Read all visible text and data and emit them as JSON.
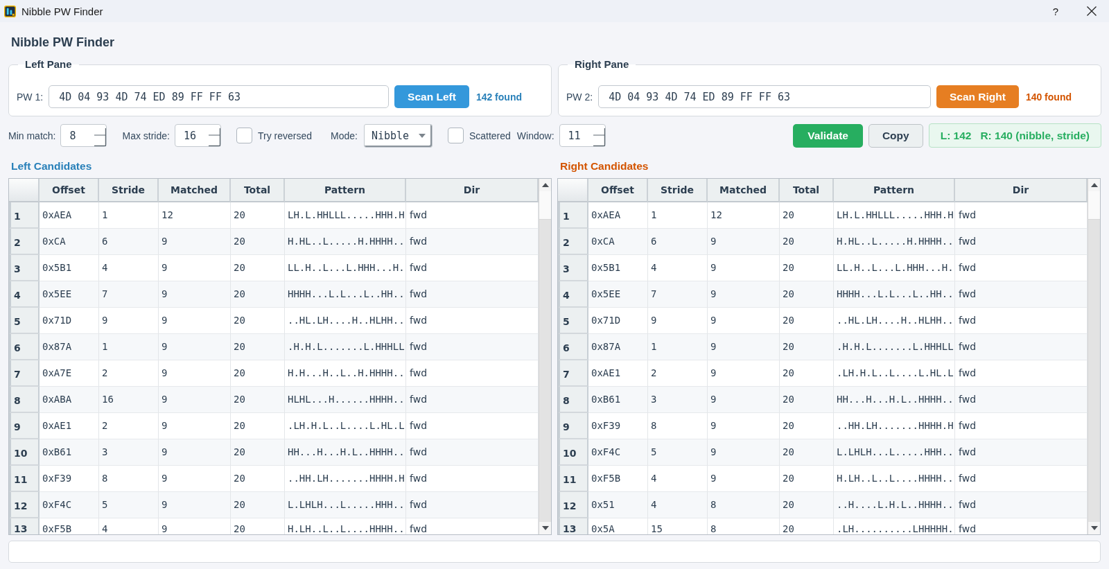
{
  "window": {
    "title": "Nibble PW Finder",
    "help_button": "?"
  },
  "heading": "Nibble PW Finder",
  "panes": [
    {
      "title": "Left Pane",
      "field_label": "PW 1:",
      "value": "4D 04 93 4D 74 ED 89 FF FF 63",
      "button": "Scan Left",
      "result": "142 found",
      "color": "#3498db"
    },
    {
      "title": "Right Pane",
      "field_label": "PW 2:",
      "value": "4D 04 93 4D 74 ED 89 FF FF 63",
      "button": "Scan Right",
      "result": "140 found",
      "color": "#e67e22"
    }
  ],
  "options": [
    {
      "kind": "spin",
      "label": "Min match:",
      "value": "8"
    },
    {
      "kind": "spin",
      "label": "Max stride:",
      "value": "16"
    },
    {
      "kind": "check",
      "label": "Try reversed",
      "checked": false
    },
    {
      "kind": "combo",
      "label": "Mode:",
      "value": "Nibble"
    },
    {
      "kind": "check",
      "label": "Scattered",
      "checked": false
    },
    {
      "kind": "spin",
      "label": "Window:",
      "value": "11"
    }
  ],
  "actions": [
    {
      "kind": "validate",
      "label": "Validate"
    },
    {
      "kind": "copy",
      "label": "Copy"
    }
  ],
  "status_badge": "L: 142   R: 140 (nibble, stride)",
  "candidate_tables": [
    {
      "title": "Left Candidates",
      "color": "#2980b9",
      "columns": [
        "Offset",
        "Stride",
        "Matched",
        "Total",
        "Pattern",
        "Dir"
      ],
      "rows": [
        {
          "number": "1",
          "cells": [
            "0xAEA",
            "1",
            "12",
            "20",
            "LH.L.HHLLL.....HHH.H",
            "fwd"
          ]
        },
        {
          "number": "2",
          "cells": [
            "0xCA",
            "6",
            "9",
            "20",
            "H.HL..L.....H.HHHH..",
            "fwd"
          ]
        },
        {
          "number": "3",
          "cells": [
            "0x5B1",
            "4",
            "9",
            "20",
            "LL.H..L...L.HHH...H.",
            "fwd"
          ]
        },
        {
          "number": "4",
          "cells": [
            "0x5EE",
            "7",
            "9",
            "20",
            "HHHH...L.L...L..HH..",
            "fwd"
          ]
        },
        {
          "number": "5",
          "cells": [
            "0x71D",
            "9",
            "9",
            "20",
            "..HL.LH....H..HLHH..",
            "fwd"
          ]
        },
        {
          "number": "6",
          "cells": [
            "0x87A",
            "1",
            "9",
            "20",
            ".H.H.L.......L.HHHLL",
            "fwd"
          ]
        },
        {
          "number": "7",
          "cells": [
            "0xA7E",
            "2",
            "9",
            "20",
            "H.H...H..L..H.HHHH..",
            "fwd"
          ]
        },
        {
          "number": "8",
          "cells": [
            "0xABA",
            "16",
            "9",
            "20",
            "HLHL...H......HHHH..",
            "fwd"
          ]
        },
        {
          "number": "9",
          "cells": [
            "0xAE1",
            "2",
            "9",
            "20",
            ".LH.H.L..L....L.HL.L",
            "fwd"
          ]
        },
        {
          "number": "10",
          "cells": [
            "0xB61",
            "3",
            "9",
            "20",
            "HH...H...H.L..HHHH..",
            "fwd"
          ]
        },
        {
          "number": "11",
          "cells": [
            "0xF39",
            "8",
            "9",
            "20",
            "..HH.LH.......HHHH.H",
            "fwd"
          ]
        },
        {
          "number": "12",
          "cells": [
            "0xF4C",
            "5",
            "9",
            "20",
            "L.LHLH...L.....HHH..",
            "fwd"
          ]
        },
        {
          "number": "13",
          "cells": [
            "0xF5B",
            "4",
            "9",
            "20",
            "H.LH..L..L....HHHH..",
            "fwd"
          ]
        }
      ]
    },
    {
      "title": "Right Candidates",
      "color": "#d35400",
      "columns": [
        "Offset",
        "Stride",
        "Matched",
        "Total",
        "Pattern",
        "Dir"
      ],
      "rows": [
        {
          "number": "1",
          "cells": [
            "0xAEA",
            "1",
            "12",
            "20",
            "LH.L.HHLLL.....HHH.H",
            "fwd"
          ]
        },
        {
          "number": "2",
          "cells": [
            "0xCA",
            "6",
            "9",
            "20",
            "H.HL..L.....H.HHHH..",
            "fwd"
          ]
        },
        {
          "number": "3",
          "cells": [
            "0x5B1",
            "4",
            "9",
            "20",
            "LL.H..L...L.HHH...H.",
            "fwd"
          ]
        },
        {
          "number": "4",
          "cells": [
            "0x5EE",
            "7",
            "9",
            "20",
            "HHHH...L.L...L..HH..",
            "fwd"
          ]
        },
        {
          "number": "5",
          "cells": [
            "0x71D",
            "9",
            "9",
            "20",
            "..HL.LH....H..HLHH..",
            "fwd"
          ]
        },
        {
          "number": "6",
          "cells": [
            "0x87A",
            "1",
            "9",
            "20",
            ".H.H.L.......L.HHHLL",
            "fwd"
          ]
        },
        {
          "number": "7",
          "cells": [
            "0xAE1",
            "2",
            "9",
            "20",
            ".LH.H.L..L....L.HL.L",
            "fwd"
          ]
        },
        {
          "number": "8",
          "cells": [
            "0xB61",
            "3",
            "9",
            "20",
            "HH...H...H.L..HHHH..",
            "fwd"
          ]
        },
        {
          "number": "9",
          "cells": [
            "0xF39",
            "8",
            "9",
            "20",
            "..HH.LH.......HHHH.H",
            "fwd"
          ]
        },
        {
          "number": "10",
          "cells": [
            "0xF4C",
            "5",
            "9",
            "20",
            "L.LHLH...L.....HHH..",
            "fwd"
          ]
        },
        {
          "number": "11",
          "cells": [
            "0xF5B",
            "4",
            "9",
            "20",
            "H.LH..L..L....HHHH..",
            "fwd"
          ]
        },
        {
          "number": "12",
          "cells": [
            "0x51",
            "4",
            "8",
            "20",
            "..H....L.H.L..HHHH..",
            "fwd"
          ]
        },
        {
          "number": "13",
          "cells": [
            "0x5A",
            "15",
            "8",
            "20",
            ".LH..........LHHHHH.",
            "fwd"
          ]
        }
      ]
    }
  ]
}
